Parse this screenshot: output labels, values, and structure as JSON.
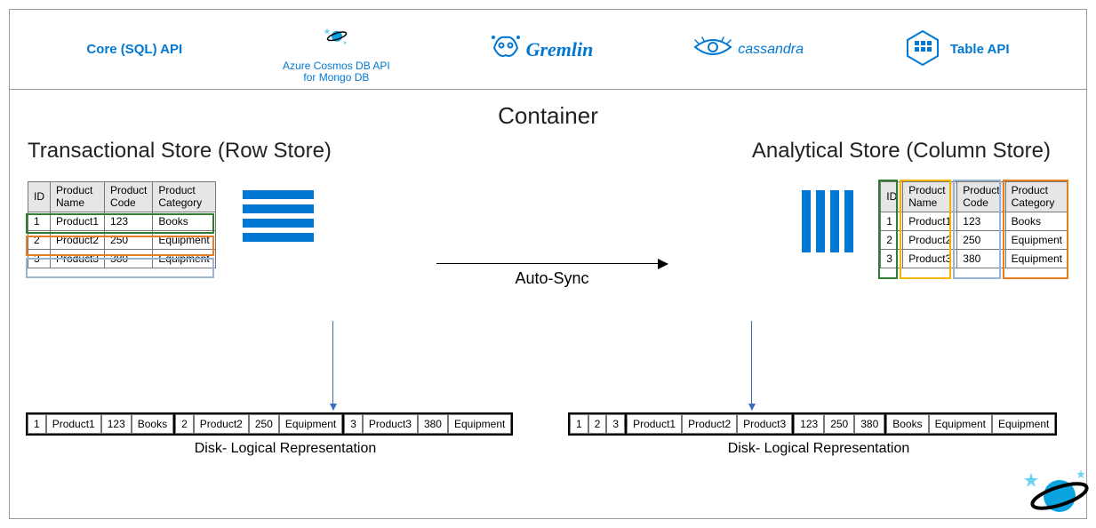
{
  "api_row": {
    "core": {
      "label": "Core (SQL) API"
    },
    "cosmos": {
      "line1": "Azure Cosmos DB API",
      "line2": "for Mongo DB"
    },
    "gremlin": {
      "label": "Gremlin"
    },
    "cassandra": {
      "label": "cassandra"
    },
    "table": {
      "label": "Table API"
    }
  },
  "container_title": "Container",
  "left_store_title": "Transactional Store (Row Store)",
  "right_store_title": "Analytical Store (Column Store)",
  "auto_sync_label": "Auto-Sync",
  "table_headers": {
    "id": "ID",
    "name1": "Product",
    "name2": "Name",
    "code1": "Product",
    "code2": "Code",
    "cat1": "Product",
    "cat2": "Category"
  },
  "products": [
    {
      "id": "1",
      "name": "Product1",
      "code": "123",
      "cat": "Books"
    },
    {
      "id": "2",
      "name": "Product2",
      "code": "250",
      "cat": "Equipment"
    },
    {
      "id": "3",
      "name": "Product3",
      "code": "380",
      "cat": "Equipment"
    }
  ],
  "disk_label": "Disk- Logical Representation",
  "row_disk_segments": [
    {
      "color": "c-green",
      "cells": [
        "1",
        "Product1",
        "123",
        "Books"
      ]
    },
    {
      "color": "c-orange",
      "cells": [
        "2",
        "Product2",
        "250",
        "Equipment"
      ]
    },
    {
      "color": "c-blue",
      "cells": [
        "3",
        "Product3",
        "380",
        "Equipment"
      ]
    }
  ],
  "col_disk_segments": [
    {
      "color": "c-green",
      "cells": [
        "1",
        "2",
        "3"
      ]
    },
    {
      "color": "c-orange",
      "cells": [
        "Product1",
        "Product2",
        "Product3"
      ]
    },
    {
      "color": "c-blue",
      "cells": [
        "123",
        "250",
        "380"
      ]
    },
    {
      "color": "c-orange",
      "cells": [
        "Books",
        "Equipment",
        "Equipment"
      ]
    }
  ],
  "row_highlight_colors": [
    "c-green",
    "c-orange",
    "c-blue"
  ],
  "col_highlight_colors": [
    "c-green",
    "c-yellow",
    "c-blue",
    "c-orange"
  ]
}
